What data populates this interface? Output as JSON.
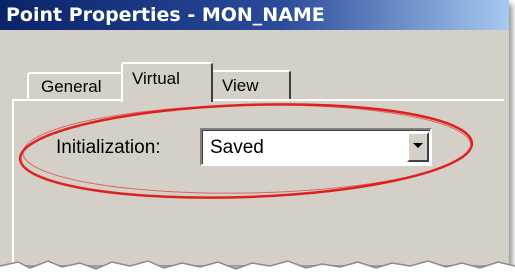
{
  "window": {
    "title": "Point Properties - MON_NAME"
  },
  "tabs": [
    {
      "label": "General",
      "selected": false
    },
    {
      "label": "Virtual",
      "selected": true
    },
    {
      "label": "View",
      "selected": false
    }
  ],
  "form": {
    "initialization_label": "Initialization:",
    "initialization_value": "Saved"
  },
  "icons": {
    "dropdown_arrow": "chevron-down-icon"
  },
  "colors": {
    "titlebar": "#0a246a",
    "highlight": "#e02020",
    "face": "#d4d0c8"
  }
}
